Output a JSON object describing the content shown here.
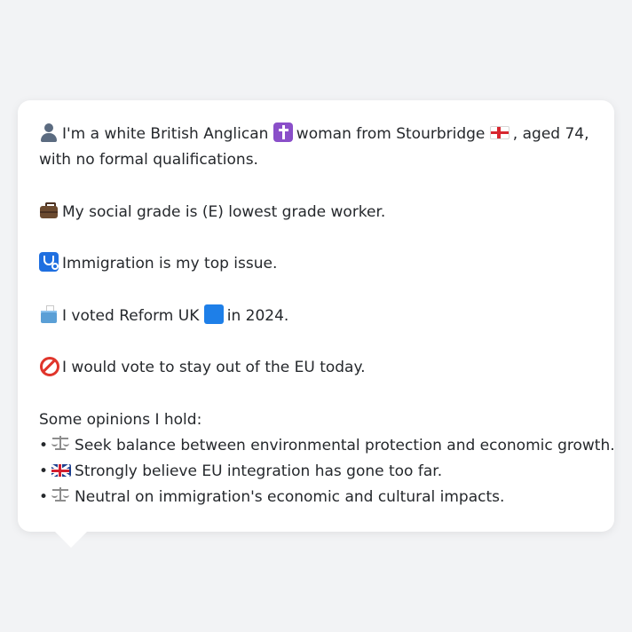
{
  "profile": {
    "identity_line_1": "I'm a white British Anglican",
    "identity_line_2": "woman from Stourbridge",
    "identity_line_3": ", aged 74,",
    "identity_line_4": "with no formal qualifications.",
    "social_grade": "My social grade is (E) lowest grade worker.",
    "top_issue": "Immigration is my top issue.",
    "vote_prefix": "I voted Reform UK",
    "vote_suffix": "in 2024.",
    "eu_stance": "I would vote to stay out of the EU today."
  },
  "opinions": {
    "heading": "Some opinions I hold:",
    "bullet": "•",
    "items": [
      {
        "icon": "scales-icon",
        "text": "Seek balance between environmental protection and economic growth."
      },
      {
        "icon": "uk-flag-icon",
        "text": "Strongly believe EU integration has gone too far."
      },
      {
        "icon": "scales-icon",
        "text": "Neutral on immigration's economic and cultural impacts."
      }
    ]
  },
  "icons": [
    "person-icon",
    "latin-cross-icon",
    "england-flag-icon",
    "briefcase-icon",
    "stethoscope-icon",
    "ballot-box-icon",
    "blue-square-icon",
    "no-entry-icon",
    "scales-icon",
    "uk-flag-icon"
  ],
  "colors": {
    "page_background": "#f2f3f5",
    "bubble_background": "#ffffff",
    "text": "#25282c"
  }
}
